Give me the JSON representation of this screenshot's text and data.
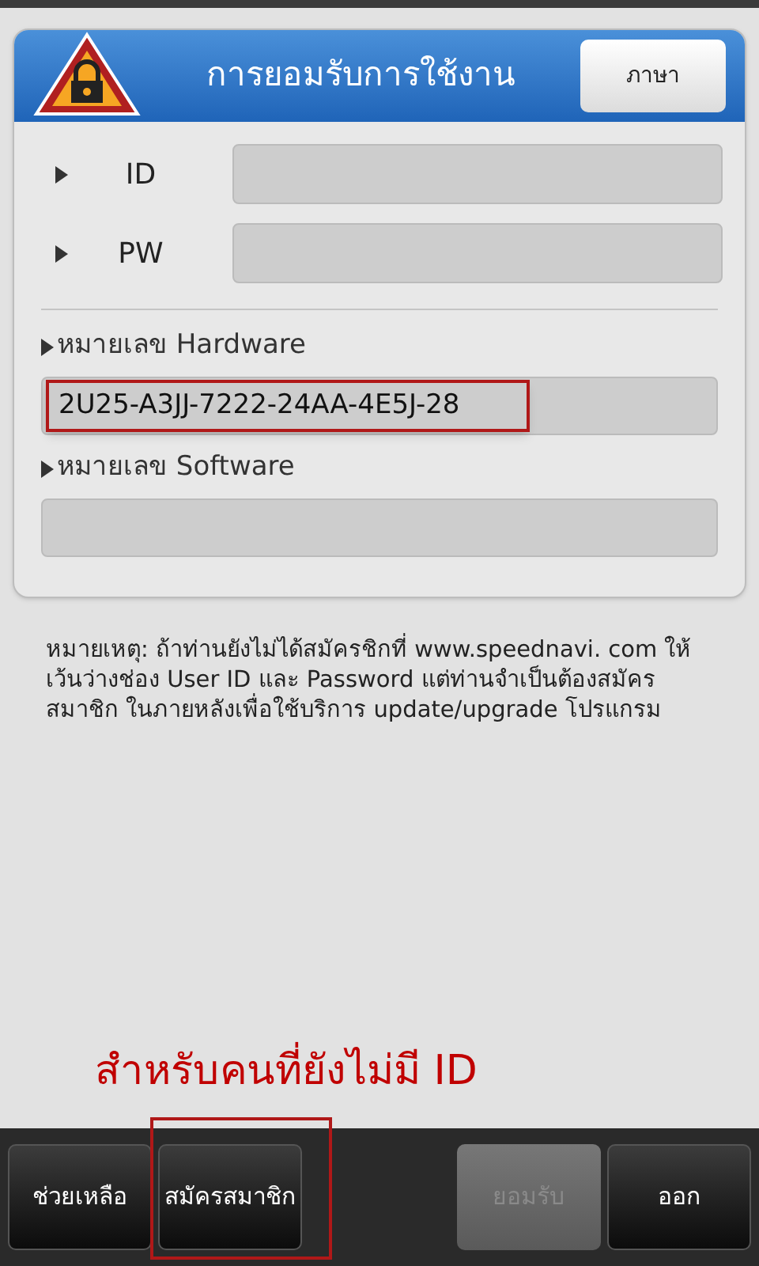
{
  "header": {
    "title": "การยอมรับการใช้งาน",
    "language_button": "ภาษา"
  },
  "login_fields": [
    {
      "label": "ID"
    },
    {
      "label": "PW"
    }
  ],
  "info_fields": [
    {
      "label": "หมายเลข Hardware",
      "value": "2U25-A3JJ-7222-24AA-4E5J-28",
      "highlighted": true
    },
    {
      "label": "หมายเลข Software",
      "highlighted": false
    }
  ],
  "note": "หมายเหตุ: ถ้าท่านยังไม่ได้สมัครชิกที่ www.speednavi. com ให้เว้นว่างช่อง User ID และ Password แต่ท่านจำเป็นต้องสมัครสมาชิก ในภายหลังเพื่อใช้บริการ update/upgrade โปรแกรม",
  "annotation": "สำหรับคนที่ยังไม่มี ID",
  "buttons": [
    {
      "label": "ช่วยเหลือ",
      "disabled": false,
      "highlighted": false
    },
    {
      "label": "สมัครสมาชิก",
      "disabled": false,
      "highlighted": true
    },
    {
      "label": "ยอมรับ",
      "disabled": true,
      "highlighted": false
    },
    {
      "label": "ออก",
      "disabled": false,
      "highlighted": false
    }
  ]
}
